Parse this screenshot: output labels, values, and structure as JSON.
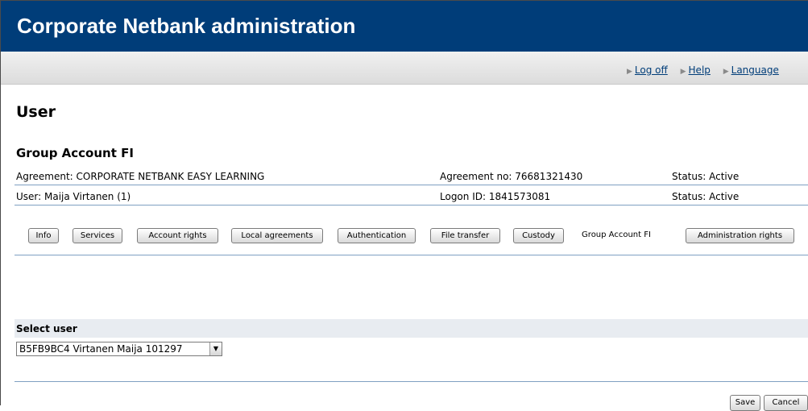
{
  "header": {
    "title": "Corporate Netbank administration"
  },
  "toplinks": [
    {
      "label": "Log off"
    },
    {
      "label": "Help"
    },
    {
      "label": "Language"
    }
  ],
  "page": {
    "heading": "User",
    "subheading": "Group Account FI"
  },
  "agreement": {
    "label": "Agreement: CORPORATE NETBANK EASY LEARNING",
    "number": "Agreement no: 76681321430",
    "status": "Status: Active"
  },
  "user": {
    "label": "User: Maija Virtanen (1)",
    "logon": "Logon ID: 1841573081",
    "status": "Status: Active"
  },
  "tabs": [
    {
      "label": "Info"
    },
    {
      "label": "Services"
    },
    {
      "label": "Account rights"
    },
    {
      "label": "Local agreements"
    },
    {
      "label": "Authentication"
    },
    {
      "label": "File transfer"
    },
    {
      "label": "Custody"
    },
    {
      "label": "Group Account FI",
      "active": true
    },
    {
      "label": "Administration rights"
    }
  ],
  "select_user": {
    "label": "Select user",
    "value": "B5FB9BC4 Virtanen Maija 101297"
  },
  "buttons": {
    "save": "Save",
    "cancel": "Cancel"
  }
}
